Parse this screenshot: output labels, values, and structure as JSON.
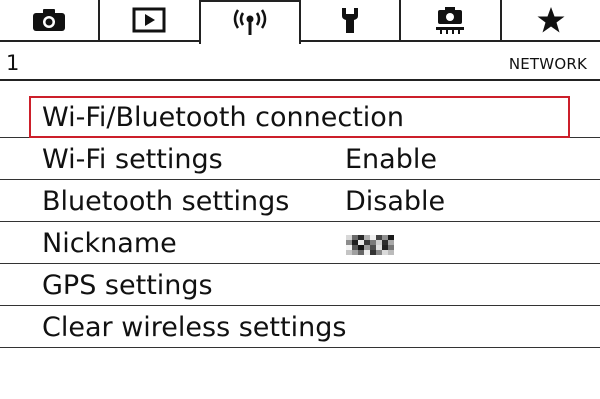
{
  "tabs": [
    {
      "id": "shooting",
      "icon": "camera-icon",
      "active": false
    },
    {
      "id": "playback",
      "icon": "playback-icon",
      "active": false
    },
    {
      "id": "network",
      "icon": "wireless-icon",
      "active": true
    },
    {
      "id": "setup",
      "icon": "wrench-icon",
      "active": false
    },
    {
      "id": "custom",
      "icon": "custom-functions-icon",
      "active": false
    },
    {
      "id": "mymenu",
      "icon": "star-icon",
      "active": false
    }
  ],
  "header": {
    "page_number": "1",
    "section_title": "NETWORK"
  },
  "menu": {
    "items": [
      {
        "label": "Wi-Fi/Bluetooth connection",
        "value": "",
        "selected": true
      },
      {
        "label": "Wi-Fi settings",
        "value": "Enable",
        "selected": false
      },
      {
        "label": "Bluetooth settings",
        "value": "Disable",
        "selected": false
      },
      {
        "label": "Nickname",
        "value": "",
        "value_redacted": true,
        "selected": false
      },
      {
        "label": "GPS settings",
        "value": "",
        "selected": false
      },
      {
        "label": "Clear wireless settings",
        "value": "",
        "selected": false
      }
    ]
  },
  "colors": {
    "selection_border": "#cc1f2a",
    "text": "#111111",
    "background": "#ffffff"
  }
}
